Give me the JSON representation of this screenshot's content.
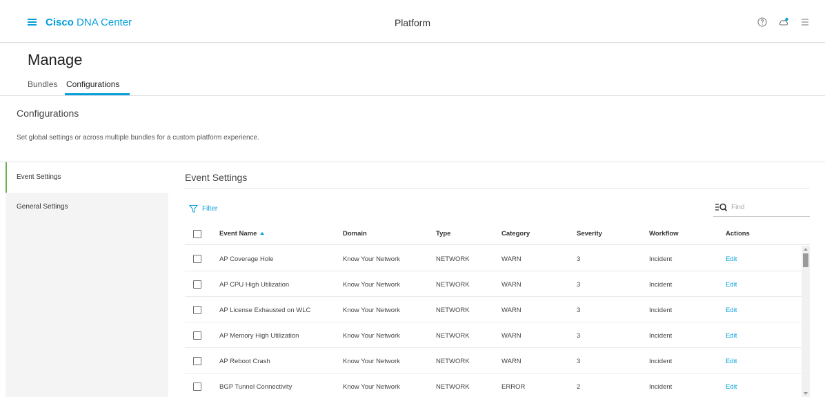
{
  "header": {
    "brand_bold": "Cisco",
    "brand_rest": " DNA Center",
    "center_title": "Platform",
    "icons": [
      "help-icon",
      "cloud-notification-icon",
      "menu-icon"
    ]
  },
  "page": {
    "title": "Manage",
    "tabs": [
      {
        "label": "Bundles",
        "active": false
      },
      {
        "label": "Configurations",
        "active": true
      }
    ]
  },
  "config": {
    "title": "Configurations",
    "description": "Set global settings or across multiple bundles for a custom platform experience."
  },
  "sidebar": {
    "items": [
      {
        "label": "Event Settings",
        "active": true
      },
      {
        "label": "General Settings",
        "active": false
      }
    ]
  },
  "content": {
    "title": "Event Settings",
    "filter_label": "Filter",
    "find_placeholder": "Find"
  },
  "table": {
    "columns": [
      "Event Name",
      "Domain",
      "Type",
      "Category",
      "Severity",
      "Workflow",
      "Actions"
    ],
    "sorted_column": "Event Name",
    "rows": [
      {
        "name": "AP Coverage Hole",
        "domain": "Know Your Network",
        "type": "NETWORK",
        "category": "WARN",
        "severity": "3",
        "workflow": "Incident",
        "action": "Edit"
      },
      {
        "name": "AP CPU High Utilization",
        "domain": "Know Your Network",
        "type": "NETWORK",
        "category": "WARN",
        "severity": "3",
        "workflow": "Incident",
        "action": "Edit"
      },
      {
        "name": "AP License Exhausted on WLC",
        "domain": "Know Your Network",
        "type": "NETWORK",
        "category": "WARN",
        "severity": "3",
        "workflow": "Incident",
        "action": "Edit"
      },
      {
        "name": "AP Memory High Utilization",
        "domain": "Know Your Network",
        "type": "NETWORK",
        "category": "WARN",
        "severity": "3",
        "workflow": "Incident",
        "action": "Edit"
      },
      {
        "name": "AP Reboot Crash",
        "domain": "Know Your Network",
        "type": "NETWORK",
        "category": "WARN",
        "severity": "3",
        "workflow": "Incident",
        "action": "Edit"
      },
      {
        "name": "BGP Tunnel Connectivity",
        "domain": "Know Your Network",
        "type": "NETWORK",
        "category": "ERROR",
        "severity": "2",
        "workflow": "Incident",
        "action": "Edit"
      }
    ]
  },
  "colors": {
    "accent": "#049fd9",
    "active_nav_marker": "#6ab04c"
  }
}
